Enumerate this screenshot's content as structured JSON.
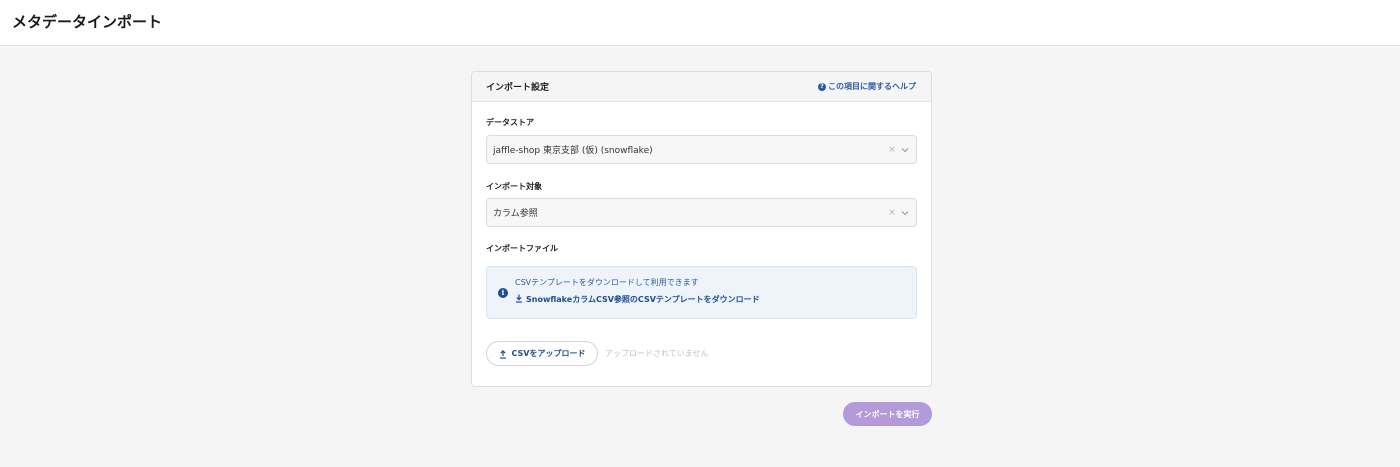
{
  "header": {
    "title": "メタデータインポート"
  },
  "import_settings": {
    "title": "インポート設定",
    "help_label": "この項目に関するヘルプ",
    "datastore": {
      "label": "データストア",
      "value": "jaffle-shop 東京支部 (仮) (snowflake)",
      "clear": "×"
    },
    "target": {
      "label": "インポート対象",
      "value": "カラム参照",
      "clear": "×"
    },
    "file": {
      "label": "インポートファイル",
      "info_text": "CSVテンプレートをダウンロードして利用できます",
      "download_link": "SnowflakeカラムCSV参照のCSVテンプレートをダウンロード",
      "upload_button": "CSVをアップロード",
      "upload_status": "アップロードされていません"
    }
  },
  "actions": {
    "run_label": "インポートを実行"
  },
  "colors": {
    "accent": "#1e4d91",
    "run_button": "#b39ad8",
    "info_bg": "#eef4fa"
  }
}
